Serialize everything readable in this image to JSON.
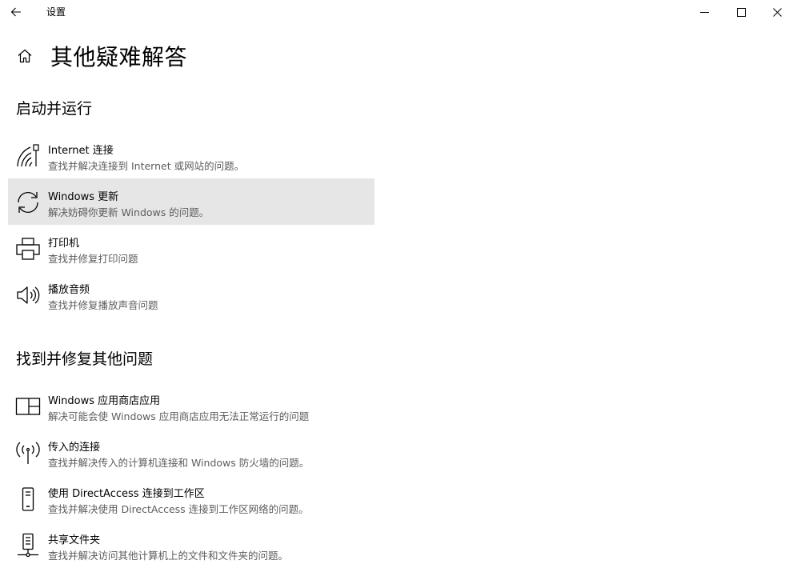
{
  "window": {
    "title": "设置",
    "back_icon": "arrow-left-icon",
    "minimize_icon": "minimize-icon",
    "maximize_icon": "maximize-icon",
    "close_icon": "close-icon"
  },
  "header": {
    "home_icon": "home-icon",
    "title": "其他疑难解答"
  },
  "sections": [
    {
      "title": "启动并运行",
      "items": [
        {
          "icon": "wifi-network-icon",
          "name": "Internet 连接",
          "desc": "查找并解决连接到 Internet 或网站的问题。"
        },
        {
          "icon": "sync-icon",
          "name": "Windows 更新",
          "desc": "解决妨碍你更新 Windows 的问题。"
        },
        {
          "icon": "printer-icon",
          "name": "打印机",
          "desc": "查找并修复打印问题"
        },
        {
          "icon": "speaker-icon",
          "name": "播放音频",
          "desc": "查找并修复播放声音问题"
        }
      ]
    },
    {
      "title": "找到并修复其他问题",
      "items": [
        {
          "icon": "store-apps-icon",
          "name": "Windows 应用商店应用",
          "desc": "解决可能会使 Windows 应用商店应用无法正常运行的问题"
        },
        {
          "icon": "antenna-icon",
          "name": "传入的连接",
          "desc": "查找并解决传入的计算机连接和 Windows 防火墙的问题。"
        },
        {
          "icon": "phone-device-icon",
          "name": "使用 DirectAccess 连接到工作区",
          "desc": "查找并解决使用 DirectAccess 连接到工作区网络的问题。"
        },
        {
          "icon": "shared-folder-icon",
          "name": "共享文件夹",
          "desc": "查找并解决访问其他计算机上的文件和文件夹的问题。"
        }
      ]
    }
  ],
  "colors": {
    "hover_bg": "#e6e6e6",
    "desc_text": "#5d5d5d"
  }
}
